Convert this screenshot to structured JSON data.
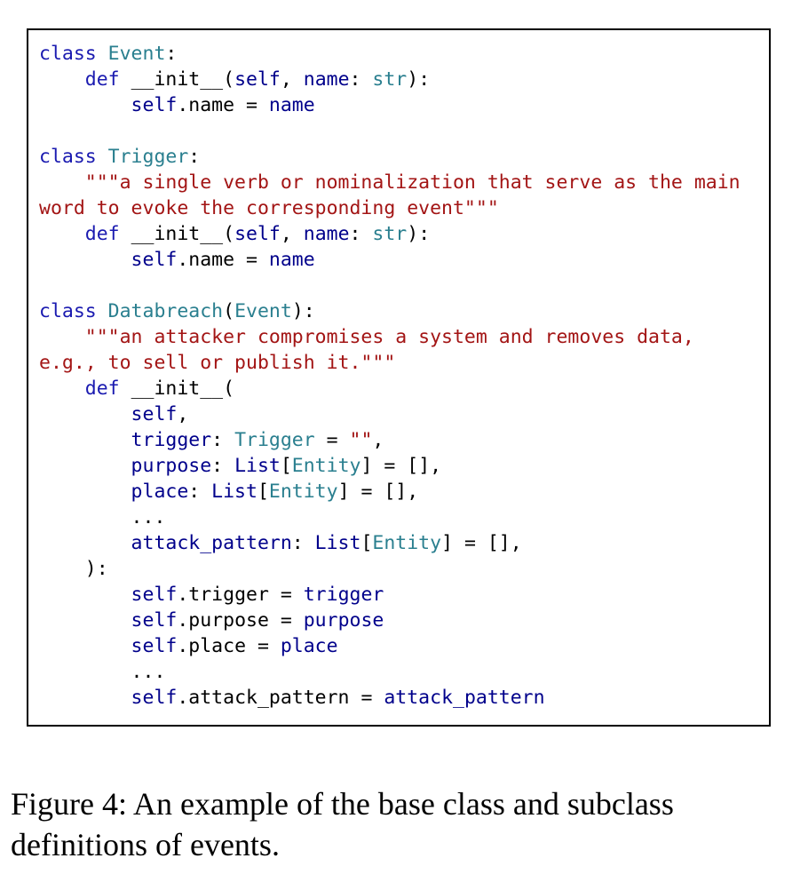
{
  "code_lines": [
    [
      {
        "t": "class ",
        "c": "keyword"
      },
      {
        "t": "Event",
        "c": "classname"
      },
      {
        "t": ":",
        "c": "plain"
      }
    ],
    [
      {
        "t": "    def ",
        "c": "keyword"
      },
      {
        "t": "__init__",
        "c": "plain"
      },
      {
        "t": "(",
        "c": "plain"
      },
      {
        "t": "self",
        "c": "name"
      },
      {
        "t": ", ",
        "c": "plain"
      },
      {
        "t": "name",
        "c": "name"
      },
      {
        "t": ": ",
        "c": "plain"
      },
      {
        "t": "str",
        "c": "type"
      },
      {
        "t": "):",
        "c": "plain"
      }
    ],
    [
      {
        "t": "        self",
        "c": "name"
      },
      {
        "t": ".name = ",
        "c": "plain"
      },
      {
        "t": "name",
        "c": "name"
      }
    ],
    [],
    [
      {
        "t": "class ",
        "c": "keyword"
      },
      {
        "t": "Trigger",
        "c": "classname"
      },
      {
        "t": ":",
        "c": "plain"
      }
    ],
    [
      {
        "t": "    \"\"\"a single verb or nominalization that serve as the main",
        "c": "string"
      }
    ],
    [
      {
        "t": "word to evoke the corresponding event\"\"\"",
        "c": "string"
      }
    ],
    [
      {
        "t": "    def ",
        "c": "keyword"
      },
      {
        "t": "__init__",
        "c": "plain"
      },
      {
        "t": "(",
        "c": "plain"
      },
      {
        "t": "self",
        "c": "name"
      },
      {
        "t": ", ",
        "c": "plain"
      },
      {
        "t": "name",
        "c": "name"
      },
      {
        "t": ": ",
        "c": "plain"
      },
      {
        "t": "str",
        "c": "type"
      },
      {
        "t": "):",
        "c": "plain"
      }
    ],
    [
      {
        "t": "        self",
        "c": "name"
      },
      {
        "t": ".name = ",
        "c": "plain"
      },
      {
        "t": "name",
        "c": "name"
      }
    ],
    [],
    [
      {
        "t": "class ",
        "c": "keyword"
      },
      {
        "t": "Databreach",
        "c": "classname"
      },
      {
        "t": "(",
        "c": "plain"
      },
      {
        "t": "Event",
        "c": "classname"
      },
      {
        "t": "):",
        "c": "plain"
      }
    ],
    [
      {
        "t": "    \"\"\"an attacker compromises a system and removes data,",
        "c": "string"
      }
    ],
    [
      {
        "t": "e.g., to sell or publish it.\"\"\"",
        "c": "string"
      }
    ],
    [
      {
        "t": "    def ",
        "c": "keyword"
      },
      {
        "t": "__init__",
        "c": "plain"
      },
      {
        "t": "(",
        "c": "plain"
      }
    ],
    [
      {
        "t": "        self",
        "c": "name"
      },
      {
        "t": ",",
        "c": "plain"
      }
    ],
    [
      {
        "t": "        trigger",
        "c": "name"
      },
      {
        "t": ": ",
        "c": "plain"
      },
      {
        "t": "Trigger",
        "c": "type"
      },
      {
        "t": " = ",
        "c": "plain"
      },
      {
        "t": "\"\"",
        "c": "string"
      },
      {
        "t": ",",
        "c": "plain"
      }
    ],
    [
      {
        "t": "        purpose",
        "c": "name"
      },
      {
        "t": ": ",
        "c": "plain"
      },
      {
        "t": "List",
        "c": "name"
      },
      {
        "t": "[",
        "c": "plain"
      },
      {
        "t": "Entity",
        "c": "type"
      },
      {
        "t": "] = [],",
        "c": "plain"
      }
    ],
    [
      {
        "t": "        place",
        "c": "name"
      },
      {
        "t": ": ",
        "c": "plain"
      },
      {
        "t": "List",
        "c": "name"
      },
      {
        "t": "[",
        "c": "plain"
      },
      {
        "t": "Entity",
        "c": "type"
      },
      {
        "t": "] = [],",
        "c": "plain"
      }
    ],
    [
      {
        "t": "        ...",
        "c": "plain"
      }
    ],
    [
      {
        "t": "        attack_pattern",
        "c": "name"
      },
      {
        "t": ": ",
        "c": "plain"
      },
      {
        "t": "List",
        "c": "name"
      },
      {
        "t": "[",
        "c": "plain"
      },
      {
        "t": "Entity",
        "c": "type"
      },
      {
        "t": "] = [],",
        "c": "plain"
      }
    ],
    [
      {
        "t": "    ):",
        "c": "plain"
      }
    ],
    [
      {
        "t": "        self",
        "c": "name"
      },
      {
        "t": ".trigger = ",
        "c": "plain"
      },
      {
        "t": "trigger",
        "c": "name"
      }
    ],
    [
      {
        "t": "        self",
        "c": "name"
      },
      {
        "t": ".purpose = ",
        "c": "plain"
      },
      {
        "t": "purpose",
        "c": "name"
      }
    ],
    [
      {
        "t": "        self",
        "c": "name"
      },
      {
        "t": ".place = ",
        "c": "plain"
      },
      {
        "t": "place",
        "c": "name"
      }
    ],
    [
      {
        "t": "        ...",
        "c": "plain"
      }
    ],
    [
      {
        "t": "        self",
        "c": "name"
      },
      {
        "t": ".attack_pattern = ",
        "c": "plain"
      },
      {
        "t": "attack_pattern",
        "c": "name"
      }
    ]
  ],
  "caption": {
    "line1": "Figure 4:  An example of the base class and subclass",
    "line2": "definitions of events."
  },
  "colors": {
    "keyword": "#1a1ab0",
    "classname": "#2a7f8f",
    "name": "#00008b",
    "string": "#a31515",
    "border": "#000000"
  }
}
